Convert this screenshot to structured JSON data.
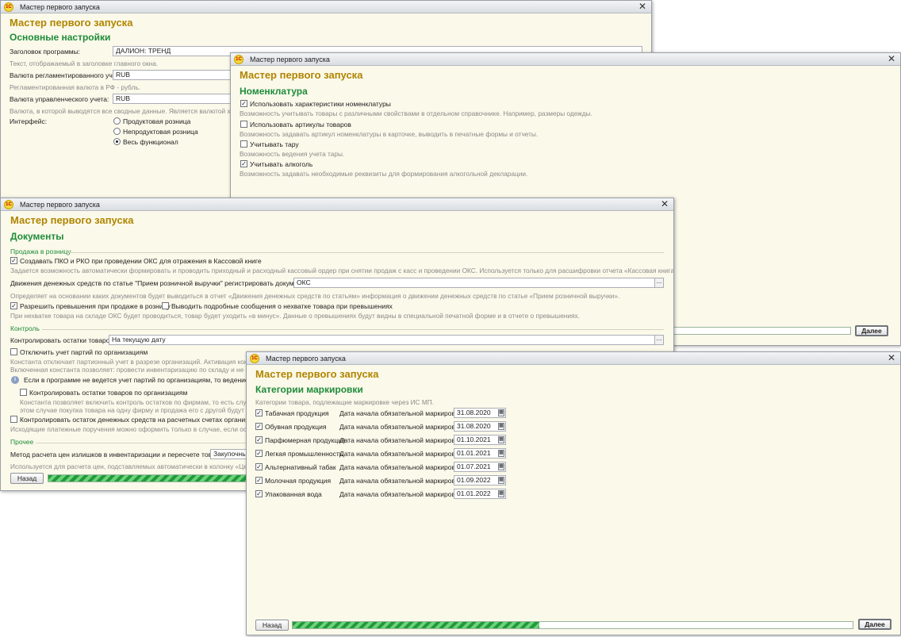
{
  "wizard_title": "Мастер первого запуска",
  "w1": {
    "heading": "Основные настройки",
    "program_title_label": "Заголовок программы:",
    "program_title_value": "ДАЛИОН: ТРЕНД",
    "program_title_hint": "Текст, отображаемый в заголовке главного окна.",
    "reg_currency_label": "Валюта регламентированного учета:",
    "reg_currency_value": "RUB",
    "reg_currency_hint": "Регламентированная валюта в РФ - рубль.",
    "mgmt_currency_label": "Валюта управленческого учета:",
    "mgmt_currency_value": "RUB",
    "mgmt_currency_hint": "Валюта, в которой выводятся все сводные данные. Является валютой хранени",
    "interface_label": "Интерфейс:",
    "interface_options": [
      "Продуктовая розница",
      "Непродуктовая розница",
      "Весь функционал"
    ],
    "interface_selected": 2
  },
  "w2": {
    "heading": "Номенклатура",
    "options": [
      {
        "label": "Использовать характеристики номенклатуры",
        "checked": true,
        "hint": "Возможность учитывать товары с различными свойствами в отдельном справочнике. Например, размеры одежды."
      },
      {
        "label": "Использовать артикулы товаров",
        "checked": false,
        "hint": "Возможность задавать артикул номенклатуры в карточке, выводить в печатные формы и отчеты."
      },
      {
        "label": "Учитывать тару",
        "checked": false,
        "hint": "Возможность ведения учета тары."
      },
      {
        "label": "Учитывать алкоголь",
        "checked": true,
        "hint": "Возможность задавать необходимые реквизиты для формирования алкогольной декларации."
      }
    ],
    "next_label": "Далее"
  },
  "w3": {
    "heading": "Документы",
    "group_retail": "Продажа в розницу",
    "cb_pko_label": "Создавать ПКО и РКО при проведении ОКС для отражения в Кассовой книге",
    "cb_pko_hint": "Задается возможность автоматически формировать и проводить приходный и расходный кассовый ордер при снятии продаж с касс и проведении ОКС. Используется только для расшифровки отчета «Кассовая книга (КО-4)».",
    "cash_flow_label": "Движения денежных средств по статье \"Прием розничной выручки\" регистрировать документом:",
    "cash_flow_value": "ОКС",
    "cash_flow_hint": "Определяет на основании каких документов будет выводиться в отчет «Движения денежных средств по статьям» информация о движении денежных средств по статье «Прием розничной выручки».",
    "cb_excess_label": "Разрешить превышения при продаже в розницу",
    "cb_detail_label": "Выводить подробные сообщения о нехватке товара при превышениях",
    "excess_hint": "При нехватке товара на складе ОКС будет проводиться, товар будет уходить «в минус». Данные о превышениях будут видны в специальной печатной форме и в отчете о превышениях.",
    "group_control": "Контроль",
    "control_label": "Контролировать остатки товаров:",
    "control_value": "На текущую дату",
    "cb_batches_label": "Отключить учет партий по организациям",
    "batches_hint1": "Константа отключает партионный учет в разрезе организаций. Активация констан",
    "batches_hint2": "Включенная константа позволяет: провести инвентаризацию по складу и не форм",
    "info_text": "Если в программе не ведется учет партий по организациям, то ведение учета",
    "cb_org_stock_label": "Контролировать остатки товаров по организациям",
    "org_stock_hint1": "Константа позволяет включить контроль остатков по фирмам, то есть случаи, к",
    "org_stock_hint2": "этом случае покупка товара на одну фирму и продажа его с другой будут разре",
    "cb_cash_label": "Контролировать остаток денежных средств на расчетных счетах организаций",
    "cash_hint": "Исходящие платежные поручения можно оформить только в случае, если остаток",
    "group_other": "Прочее",
    "price_method_label": "Метод расчета цен излишков в инвентаризации и пересчете товаров:",
    "price_method_value": "Закупочные",
    "price_method_hint": "Используется для расчета цен, подставляемых автоматически в колонку «Цена и",
    "back_label": "Назад",
    "progress": 0.55
  },
  "w4": {
    "heading": "Категории маркировки",
    "subtitle": "Категории товара, подлежащие маркировке через ИС МП.",
    "date_label": "Дата начала обязательной маркировки:",
    "categories": [
      {
        "name": "Табачная продукция",
        "date": "31.08.2020",
        "checked": true
      },
      {
        "name": "Обувная продукция",
        "date": "31.08.2020",
        "checked": true
      },
      {
        "name": "Парфюмерная продукция",
        "date": "01.10.2021",
        "checked": true
      },
      {
        "name": "Легкая промышленность",
        "date": "01.01.2021",
        "checked": true
      },
      {
        "name": "Альтернативный табак",
        "date": "01.07.2021",
        "checked": true
      },
      {
        "name": "Молочная продукция",
        "date": "01.09.2022",
        "checked": true
      },
      {
        "name": "Упакованная вода",
        "date": "01.01.2022",
        "checked": true
      }
    ],
    "back_label": "Назад",
    "next_label": "Далее",
    "progress": 0.44
  },
  "icons": {
    "app_logo": "1c-logo-icon",
    "close": "close-icon",
    "calendar": "calendar-icon",
    "info": "info-icon",
    "choice": "ellipsis-icon"
  }
}
